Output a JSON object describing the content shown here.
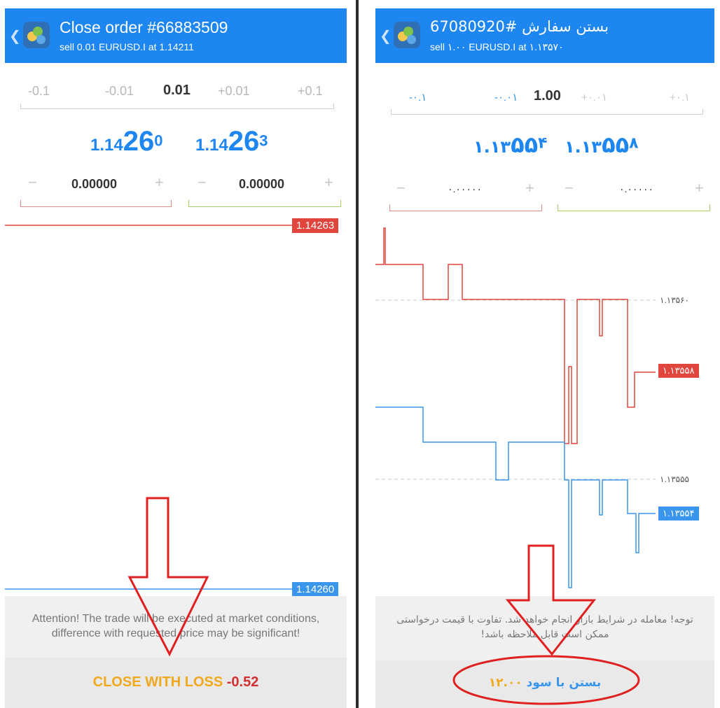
{
  "left": {
    "title": "Close order #66883509",
    "subtitle": "sell 0.01 EURUSD.I at 1.14211",
    "volume": {
      "minus_big": "-0.1",
      "minus_small": "-0.01",
      "value": "0.01",
      "plus_small": "+0.01",
      "plus_big": "+0.1"
    },
    "bid": {
      "main": "1.14",
      "big": "26",
      "sup": "0"
    },
    "ask": {
      "main": "1.14",
      "big": "26",
      "sup": "3"
    },
    "stop_loss": {
      "minus": "−",
      "value": "0.00000",
      "plus": "+"
    },
    "take_profit": {
      "minus": "−",
      "value": "0.00000",
      "plus": "+"
    },
    "ask_label": "1.14263",
    "bid_label": "1.14260",
    "attention": "Attention! The trade will be executed at market conditions, difference with requested price may be significant!",
    "close_label": "CLOSE WITH LOSS",
    "close_value": "-0.52"
  },
  "right": {
    "title": "بستن سفارش #67080920",
    "subtitle": "sell ۱.۰۰ EURUSD.I at ۱.۱۳۵۷۰",
    "volume": {
      "minus_big": "-۰.۱",
      "minus_small": "-۰.۰۱",
      "value": "1.00",
      "plus_small": "+۰.۰۱",
      "plus_big": "+۰.۱"
    },
    "bid": {
      "main": "۱.۱۳",
      "big": "۵۵",
      "sup": "۴"
    },
    "ask": {
      "main": "۱.۱۳",
      "big": "۵۵",
      "sup": "۸"
    },
    "stop_loss": {
      "minus": "−",
      "value": "۰.۰۰۰۰۰",
      "plus": "+"
    },
    "take_profit": {
      "minus": "−",
      "value": "۰.۰۰۰۰۰",
      "plus": "+"
    },
    "grid_top": "۱.۱۳۵۶۰",
    "grid_bottom": "۱.۱۳۵۵۵",
    "ask_label": "۱.۱۳۵۵۸",
    "bid_label": "۱.۱۳۵۵۴",
    "attention": "توجه! معامله در شرایط بازار انجام خواهد شد. تفاوت با قیمت درخواستی ممکن است قابل ملاحظه باشد!",
    "close_label": "بستن با سود",
    "close_value": "۱۲.۰۰"
  },
  "colors": {
    "header_blue": "#1d86f0",
    "ask_red": "#e0463e",
    "bid_blue": "#3a96ec",
    "loss_orange": "#f0a81c",
    "loss_value_red": "#d32f2f",
    "annotation_red": "#e02020"
  }
}
